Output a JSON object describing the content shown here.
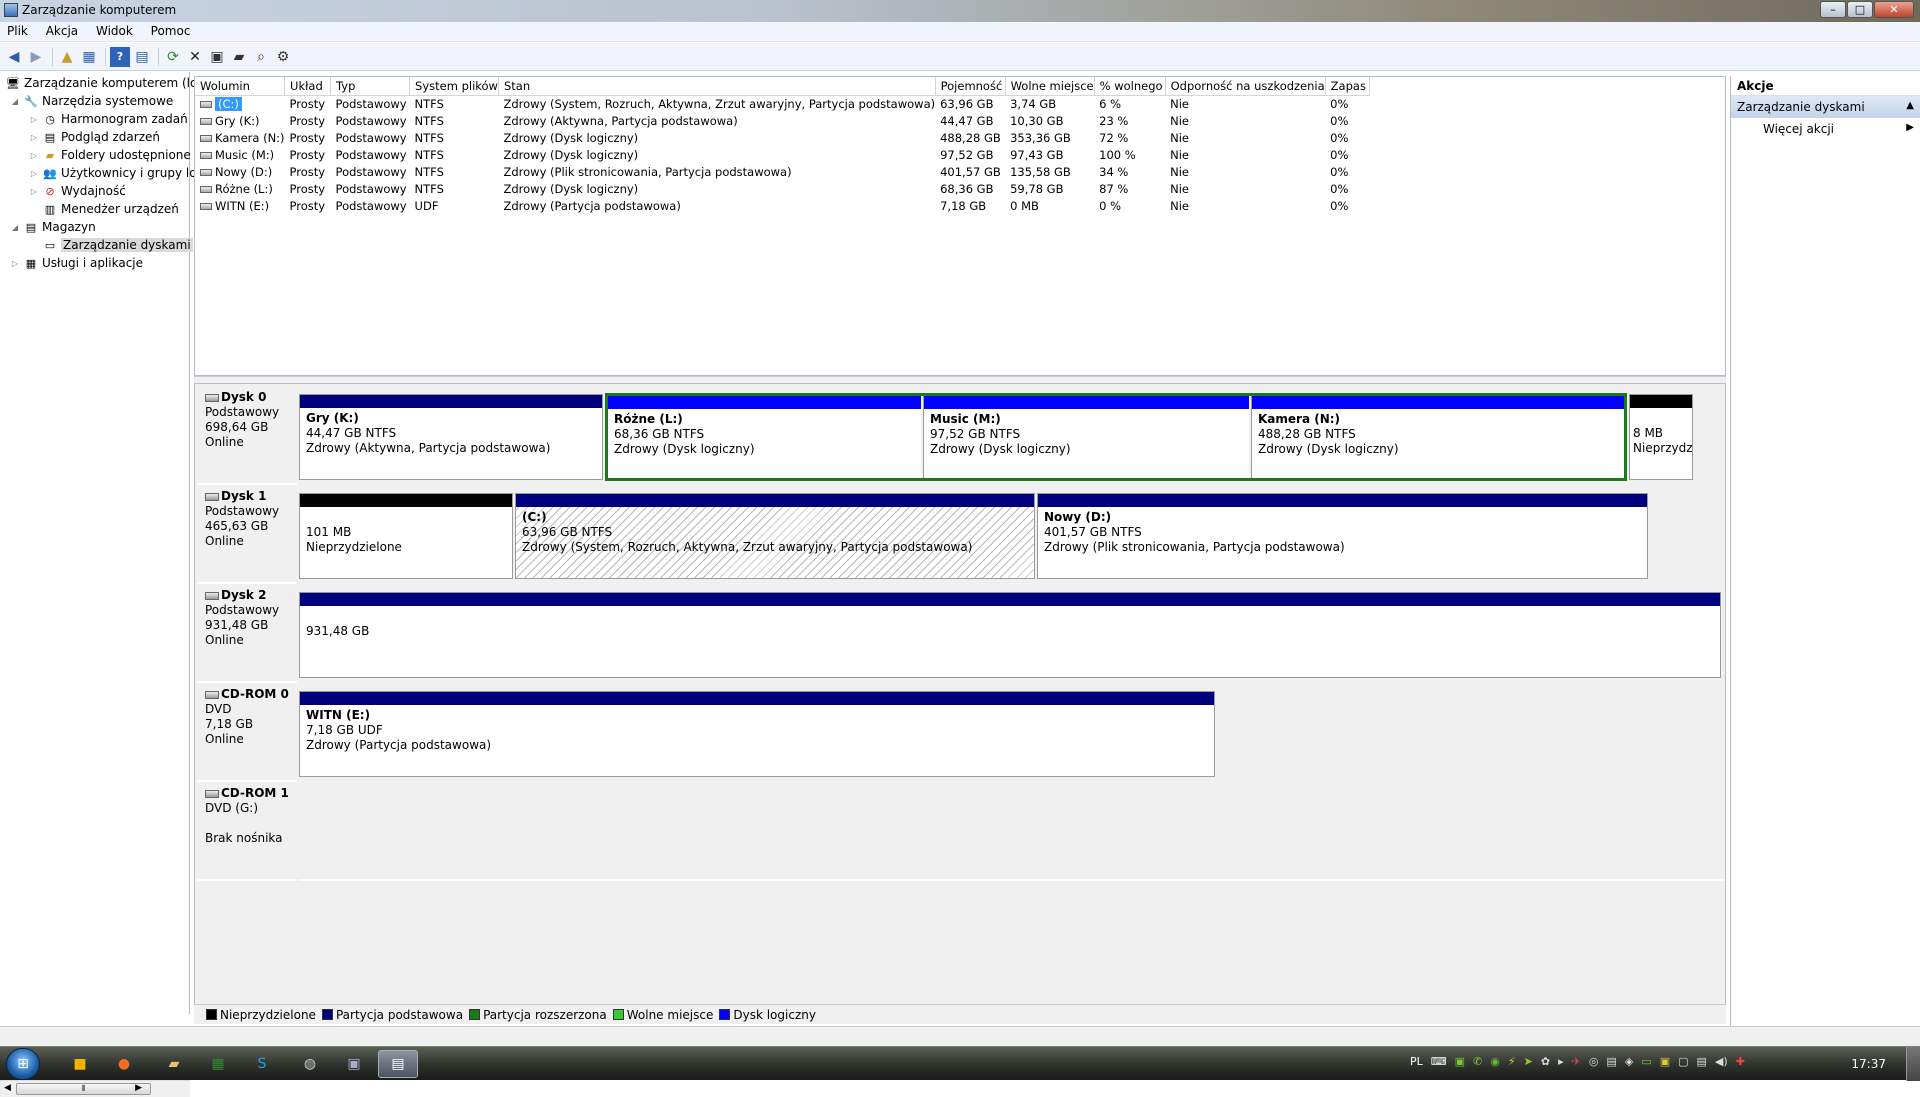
{
  "window": {
    "title": "Zarządzanie komputerem",
    "min": "–",
    "max": "□",
    "close": "✕"
  },
  "menu": [
    "Plik",
    "Akcja",
    "Widok",
    "Pomoc"
  ],
  "tree": [
    {
      "label": "Zarządzanie komputerem (loka",
      "icon": "computer-management-icon"
    },
    {
      "label": "Narzędzia systemowe",
      "icon": "tools-icon"
    },
    {
      "label": "Harmonogram zadań",
      "icon": "clock-icon"
    },
    {
      "label": "Podgląd zdarzeń",
      "icon": "event-viewer-icon"
    },
    {
      "label": "Foldery udostępnione",
      "icon": "shared-folder-icon"
    },
    {
      "label": "Użytkownicy i grupy lok",
      "icon": "users-icon"
    },
    {
      "label": "Wydajność",
      "icon": "performance-icon"
    },
    {
      "label": "Menedżer urządzeń",
      "icon": "device-manager-icon"
    },
    {
      "label": "Magazyn",
      "icon": "storage-icon"
    },
    {
      "label": "Zarządzanie dyskami",
      "icon": "disk-management-icon"
    },
    {
      "label": "Usługi i aplikacje",
      "icon": "services-icon"
    }
  ],
  "volumes": {
    "headers": [
      "Wolumin",
      "Układ",
      "Typ",
      "System plików",
      "Stan",
      "Pojemność",
      "Wolne miejsce",
      "% wolnego",
      "Odporność na uszkodzenia",
      "Zapas"
    ],
    "rows": [
      [
        "(C:)",
        "Prosty",
        "Podstawowy",
        "NTFS",
        "Zdrowy (System, Rozruch, Aktywna, Zrzut awaryjny, Partycja podstawowa)",
        "63,96 GB",
        "3,74 GB",
        "6 %",
        "Nie",
        "0%"
      ],
      [
        "Gry (K:)",
        "Prosty",
        "Podstawowy",
        "NTFS",
        "Zdrowy (Aktywna, Partycja podstawowa)",
        "44,47 GB",
        "10,30 GB",
        "23 %",
        "Nie",
        "0%"
      ],
      [
        "Kamera (N:)",
        "Prosty",
        "Podstawowy",
        "NTFS",
        "Zdrowy (Dysk logiczny)",
        "488,28 GB",
        "353,36 GB",
        "72 %",
        "Nie",
        "0%"
      ],
      [
        "Music (M:)",
        "Prosty",
        "Podstawowy",
        "NTFS",
        "Zdrowy (Dysk logiczny)",
        "97,52 GB",
        "97,43 GB",
        "100 %",
        "Nie",
        "0%"
      ],
      [
        "Nowy (D:)",
        "Prosty",
        "Podstawowy",
        "NTFS",
        "Zdrowy (Plik stronicowania, Partycja podstawowa)",
        "401,57 GB",
        "135,58 GB",
        "34 %",
        "Nie",
        "0%"
      ],
      [
        "Różne (L:)",
        "Prosty",
        "Podstawowy",
        "NTFS",
        "Zdrowy (Dysk logiczny)",
        "68,36 GB",
        "59,78 GB",
        "87 %",
        "Nie",
        "0%"
      ],
      [
        "WITN (E:)",
        "Prosty",
        "Podstawowy",
        "UDF",
        "Zdrowy (Partycja podstawowa)",
        "7,18 GB",
        "0 MB",
        "0 %",
        "Nie",
        "0%"
      ]
    ]
  },
  "disks": [
    {
      "name": "Dysk 0",
      "type": "Podstawowy",
      "size": "698,64 GB",
      "status": "Online"
    },
    {
      "name": "Dysk 1",
      "type": "Podstawowy",
      "size": "465,63 GB",
      "status": "Online"
    },
    {
      "name": "Dysk 2",
      "type": "Podstawowy",
      "size": "931,48 GB",
      "status": "Online"
    },
    {
      "name": "CD-ROM 0",
      "type": "DVD",
      "size": "7,18 GB",
      "status": "Online"
    },
    {
      "name": "CD-ROM 1",
      "type": "DVD (G:)",
      "size": "",
      "status": "Brak nośnika"
    }
  ],
  "partitions": {
    "gry": {
      "name": "Gry  (K:)",
      "size": "44,47 GB NTFS",
      "state": "Zdrowy (Aktywna, Partycja podstawowa)"
    },
    "rozne": {
      "name": "Różne  (L:)",
      "size": "68,36 GB NTFS",
      "state": "Zdrowy (Dysk logiczny)"
    },
    "music": {
      "name": "Music  (M:)",
      "size": "97,52 GB NTFS",
      "state": "Zdrowy (Dysk logiczny)"
    },
    "kamera": {
      "name": "Kamera  (N:)",
      "size": "488,28 GB NTFS",
      "state": "Zdrowy (Dysk logiczny)"
    },
    "d0unalloc": {
      "size": "8 MB",
      "state": "Nieprzydz"
    },
    "d1unalloc": {
      "size": "101 MB",
      "state": "Nieprzydzielone"
    },
    "c": {
      "name": "(C:)",
      "size": "63,96 GB NTFS",
      "state": "Zdrowy (System, Rozruch, Aktywna, Zrzut awaryjny, Partycja podstawowa)"
    },
    "nowy": {
      "name": "Nowy  (D:)",
      "size": "401,57 GB NTFS",
      "state": "Zdrowy (Plik stronicowania, Partycja podstawowa)"
    },
    "d2": {
      "size": "931,48 GB"
    },
    "witn": {
      "name": "WITN  (E:)",
      "size": "7,18 GB UDF",
      "state": "Zdrowy (Partycja podstawowa)"
    }
  },
  "legend": [
    {
      "label": "Nieprzydzielone",
      "color": "#000000"
    },
    {
      "label": "Partycja podstawowa",
      "color": "#00007f"
    },
    {
      "label": "Partycja rozszerzona",
      "color": "#1b7a1b"
    },
    {
      "label": "Wolne miejsce",
      "color": "#33cc33"
    },
    {
      "label": "Dysk logiczny",
      "color": "#0000ff"
    }
  ],
  "actions": {
    "header": "Akcje",
    "section": "Zarządzanie dyskami",
    "more": "Więcej akcji"
  },
  "taskbar": {
    "lang": "PL",
    "time": "17:37"
  }
}
